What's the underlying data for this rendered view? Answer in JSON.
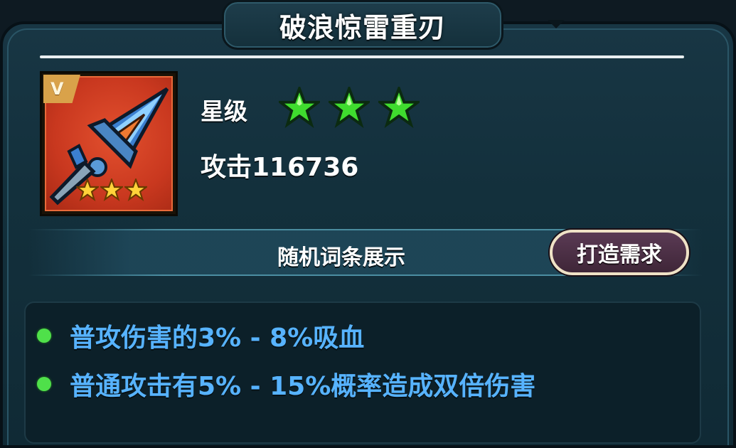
{
  "header": {
    "title": "破浪惊雷重刃"
  },
  "item": {
    "grade": "V",
    "icon": "sword-icon",
    "stars": 3,
    "frame_color": "#c9381f"
  },
  "stats": {
    "star_label": "星级",
    "star_count": 3,
    "star_color": "#3fdc2e",
    "attack": "攻击116736"
  },
  "affix_section": {
    "title": "随机词条展示",
    "forge_button": "打造需求"
  },
  "affixes": [
    "普攻伤害的3% - 8%吸血",
    "普通攻击有5% - 15%概率造成双倍伤害"
  ],
  "colors": {
    "affix_text": "#57b3ff",
    "affix_dot": "#4fe04a",
    "button_bg": "#4a2f45"
  }
}
